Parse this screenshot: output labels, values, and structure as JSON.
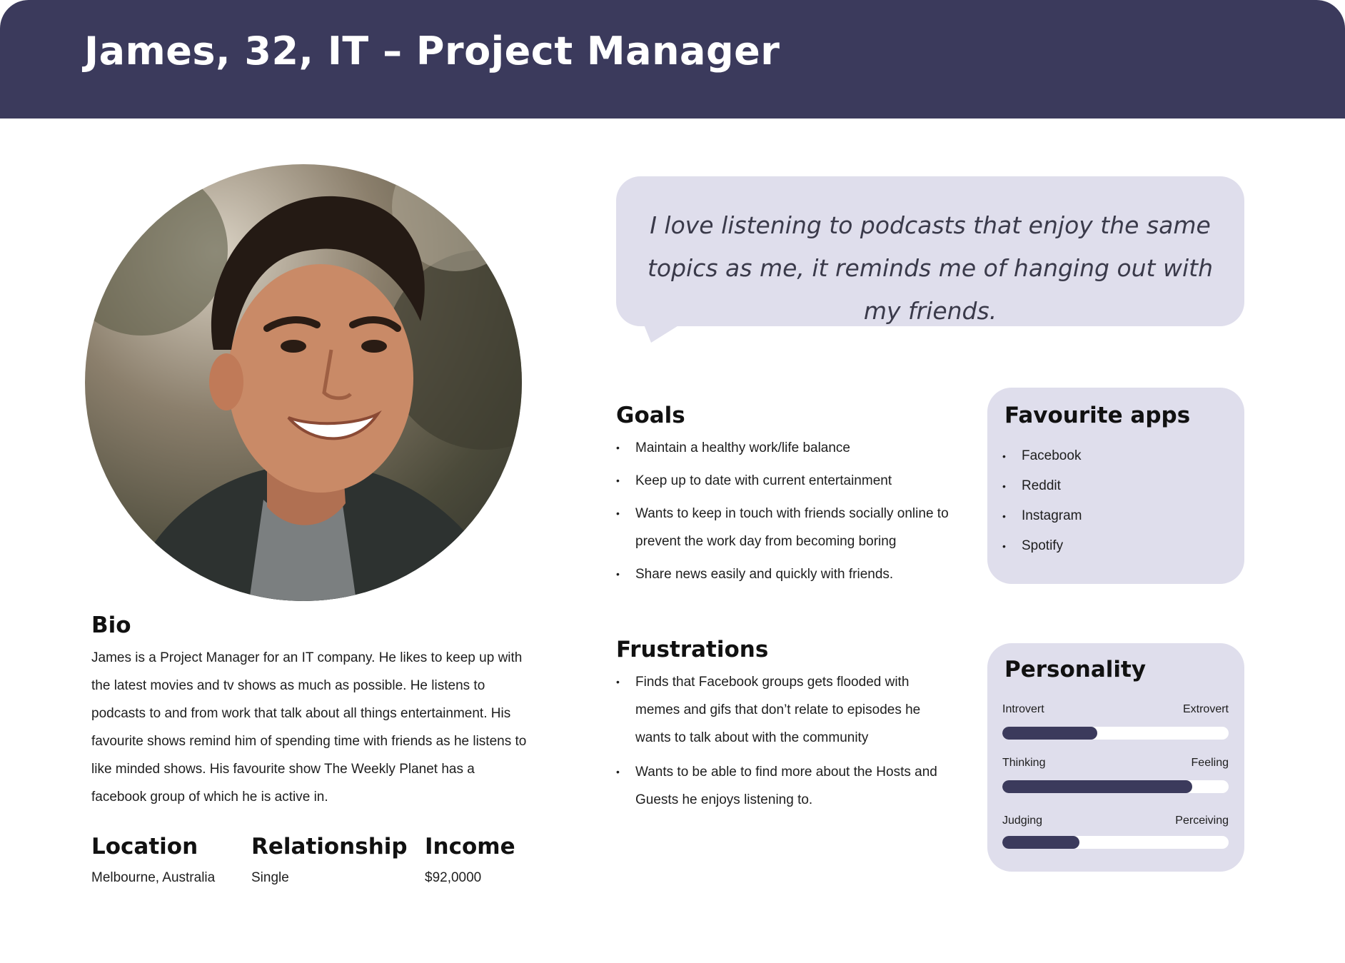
{
  "header": {
    "title": "James, 32, IT – Project Manager"
  },
  "quote": "I love listening to podcasts that enjoy the same topics as me, it reminds me of  hanging out with my friends.",
  "bio": {
    "title": "Bio",
    "text": "James is a Project Manager for an IT company. He likes to keep up with the latest movies and tv shows as much as possible. He listens to podcasts to and from work that talk about all things entertainment. His favourite shows remind him of spending time with friends as he listens to like minded shows. His favourite show The Weekly Planet has a facebook group of which he is active in."
  },
  "details": {
    "location_label": "Location",
    "location_value": "Melbourne, Australia",
    "relationship_label": "Relationship",
    "relationship_value": "Single",
    "income_label": "Income",
    "income_value": "$92,0000"
  },
  "goals": {
    "title": "Goals",
    "items": [
      "Maintain a healthy work/life balance",
      "Keep up to date with current entertainment",
      "Wants to keep in touch with friends socially online to prevent the work day from becoming boring",
      "Share news easily and quickly with friends."
    ]
  },
  "frustrations": {
    "title": "Frustrations",
    "items": [
      "Finds that Facebook groups gets flooded with memes and gifs that don’t relate to episodes he wants to talk about with the community",
      "Wants to be able to find more about the Hosts and Guests he enjoys listening to."
    ]
  },
  "apps": {
    "title": "Favourite apps",
    "items": [
      "Facebook",
      "Reddit",
      "Instagram",
      "Spotify"
    ]
  },
  "personality": {
    "title": "Personality",
    "traits": [
      {
        "left": "Introvert",
        "right": "Extrovert",
        "value": 0.42
      },
      {
        "left": "Thinking",
        "right": "Feeling",
        "value": 0.84
      },
      {
        "left": "Judging",
        "right": "Perceiving",
        "value": 0.34
      }
    ]
  },
  "colors": {
    "header": "#3b3a5c",
    "card": "#dfdeec",
    "bar": "#3b3a5c"
  }
}
